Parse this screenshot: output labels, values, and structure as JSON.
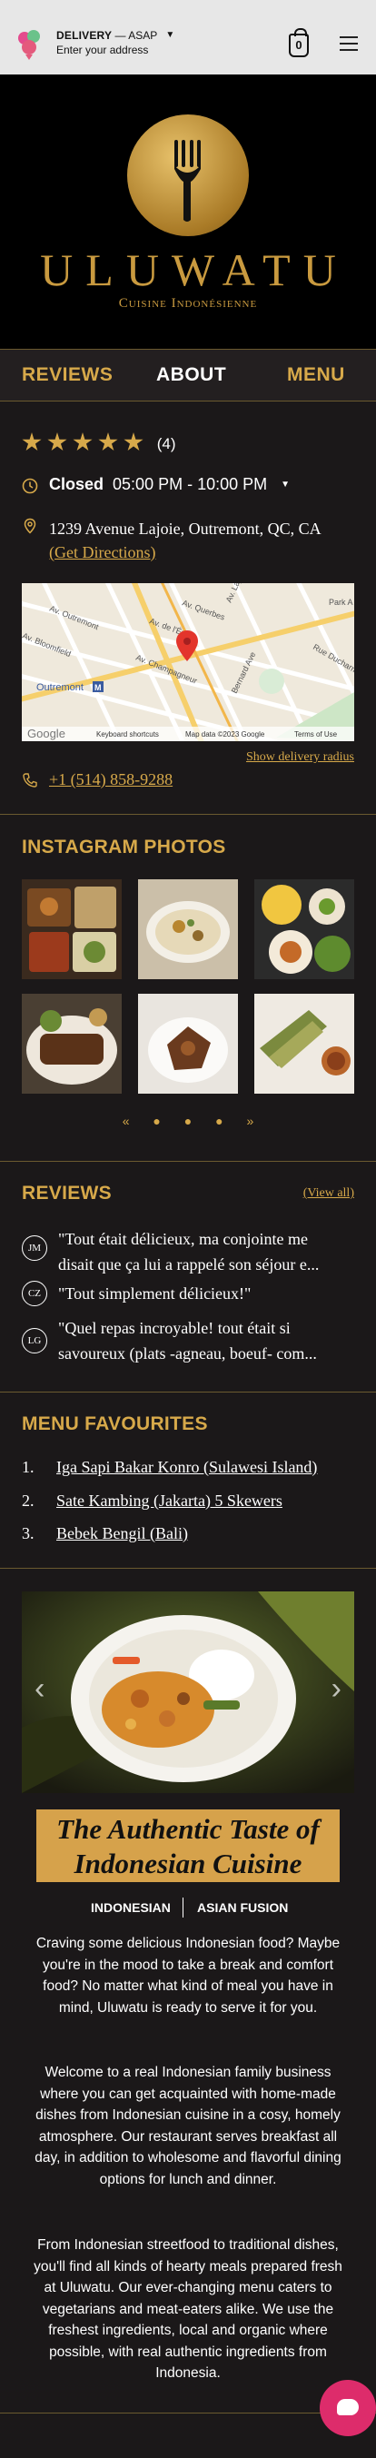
{
  "topbar": {
    "delivery_mode": "DELIVERY",
    "delivery_timing": "— ASAP",
    "address_prompt": "Enter your address",
    "cart_count": "0"
  },
  "hero": {
    "title": "ULUWATU",
    "subtitle": "Cuisine Indonésienne"
  },
  "tabs": [
    {
      "label": "REVIEWS"
    },
    {
      "label": "ABOUT"
    },
    {
      "label": "MENU"
    }
  ],
  "info": {
    "rating_stars": 5,
    "review_count": "(4)",
    "status": "Closed",
    "hours": "05:00 PM - 10:00 PM",
    "address": "1239 Avenue Lajoie, Outremont, QC, CA",
    "directions_label": "(Get Directions)",
    "delivery_radius_label": "Show delivery radius",
    "phone": "+1 (514) 858-9288"
  },
  "map": {
    "streets": [
      "Av. Querbes",
      "Av. de l'Épée",
      "Av. Outremont",
      "Av. Champagneur",
      "Av. Bloomfield",
      "Bernard Ave",
      "Av. Lajoie",
      "Park A",
      "Rue Ducharme"
    ],
    "metro_label": "Outremont",
    "provider": "Google",
    "keyboard_shortcuts": "Keyboard shortcuts",
    "map_data": "Map data ©2023 Google",
    "terms": "Terms of Use"
  },
  "instagram": {
    "heading": "INSTAGRAM PHOTOS",
    "pager": {
      "prev": "«",
      "next": "»"
    }
  },
  "reviews": {
    "heading": "REVIEWS",
    "view_all": "(View all)",
    "items": [
      {
        "initials": "JM",
        "line1": "\"Tout était délicieux, ma conjointe me",
        "line2": "disait que ça lui a rappelé son séjour e..."
      },
      {
        "initials": "CZ",
        "line1": "\"Tout simplement délicieux!\""
      },
      {
        "initials": "LG",
        "line1": "\"Quel repas incroyable! tout était si",
        "line2": "savoureux (plats -agneau, boeuf- com..."
      }
    ]
  },
  "menu_favourites": {
    "heading": "MENU FAVOURITES",
    "items": [
      {
        "num": "1.",
        "label": "Iga Sapi Bakar Konro (Sulawesi Island)"
      },
      {
        "num": "2.",
        "label": "Sate Kambing (Jakarta) 5 Skewers"
      },
      {
        "num": "3.",
        "label": "Bebek Bengil (Bali)"
      }
    ]
  },
  "carousel": {
    "prev": "‹",
    "next": "›"
  },
  "about": {
    "banner_line1": "The Authentic Taste of",
    "banner_line2": "Indonesian Cuisine",
    "cat1": "INDONESIAN",
    "cat2": "ASIAN FUSION",
    "para1": "Craving some delicious Indonesian food? Maybe you're in the mood to take a break and comfort food? No matter what kind of meal you have in mind, Uluwatu is ready to serve it for you.",
    "para2": "Welcome to a real Indonesian family business where you can get acquainted with home-made dishes from Indonesian cuisine in a cosy, homely atmosphere. Our restaurant serves breakfast all day, in addition to wholesome and flavorful dining options for lunch and dinner.",
    "para3": "From Indonesian streetfood to traditional dishes, you'll find all kinds of hearty meals prepared fresh at Uluwatu. Our ever-changing menu caters to vegetarians and meat-eaters alike. We use the freshest ingredients, local and organic where possible, with real authentic ingredients from Indonesia."
  },
  "colors": {
    "accent": "#d7a94a",
    "background": "#1b1819",
    "chat": "#dd2c6b"
  }
}
